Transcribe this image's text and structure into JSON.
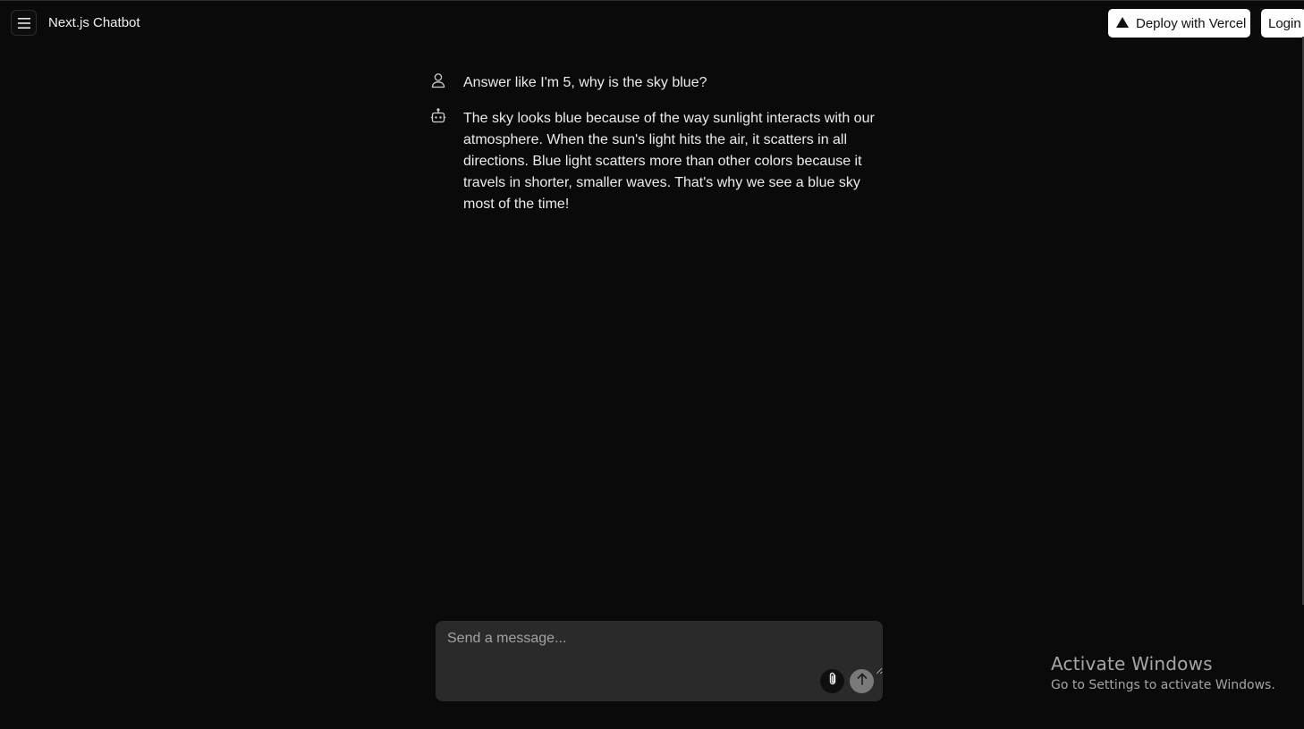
{
  "header": {
    "app_title": "Next.js Chatbot",
    "deploy_label": "Deploy with Vercel",
    "login_label": "Login"
  },
  "messages": [
    {
      "role": "user",
      "icon": "user-icon",
      "text": "Answer like I'm 5, why is the sky blue?"
    },
    {
      "role": "assistant",
      "icon": "robot-icon",
      "text": "The sky looks blue because of the way sunlight interacts with our atmosphere. When the sun's light hits the air, it scatters in all directions. Blue light scatters more than other colors because it travels in shorter, smaller waves. That's why we see a blue sky most of the time!"
    }
  ],
  "composer": {
    "placeholder": "Send a message...",
    "attach_icon": "paperclip-icon",
    "send_icon": "arrow-up-icon"
  },
  "watermark": {
    "title": "Activate Windows",
    "subtitle": "Go to Settings to activate Windows."
  },
  "colors": {
    "background": "#0a0a0b",
    "composer_bg": "#2a2a2b",
    "button_bg": "#ffffff",
    "send_button_bg": "#7a7a7a"
  }
}
